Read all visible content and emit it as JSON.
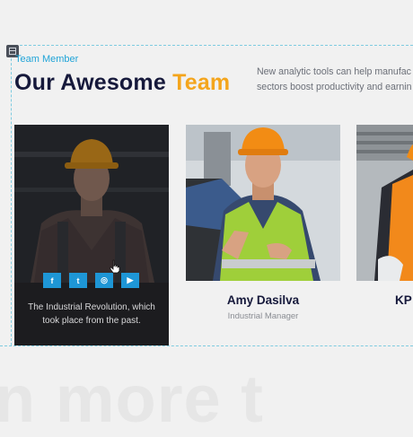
{
  "section": {
    "eyebrow": "Team Member",
    "title_part1": "Our Awesome",
    "title_part2": "Team",
    "intro_line1": "New analytic tools can help manufac",
    "intro_line2": "sectors boost productivity and earnin"
  },
  "cards": [
    {
      "description_line1": "The Industrial Revolution, which",
      "description_line2": "took place from the past.",
      "socials": [
        {
          "icon": "facebook-icon",
          "glyph": "f"
        },
        {
          "icon": "twitter-icon",
          "glyph": "t"
        },
        {
          "icon": "instagram-icon",
          "glyph": "◎"
        },
        {
          "icon": "youtube-icon",
          "glyph": "▶"
        }
      ]
    },
    {
      "name": "Amy Dasilva",
      "role": "Industrial Manager"
    },
    {
      "name": "KP"
    }
  ],
  "background_text": "n more t",
  "colors": {
    "accent_blue": "#20a4d8",
    "accent_orange": "#f4a51c",
    "navy": "#16193b",
    "social_blue": "#1e96d6"
  }
}
